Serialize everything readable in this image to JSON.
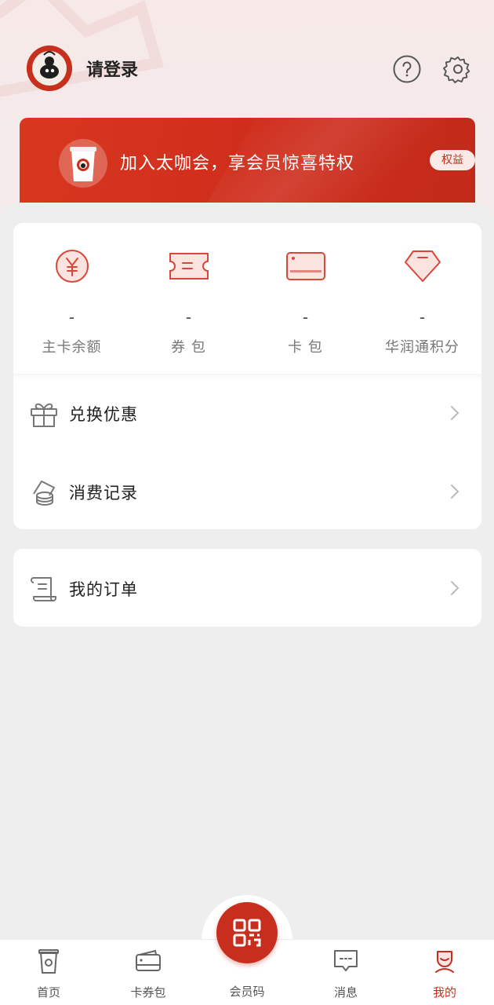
{
  "header": {
    "login_text": "请登录"
  },
  "banner": {
    "text": "加入太咖会，享会员惊喜特权",
    "badge": "权益"
  },
  "assets": [
    {
      "value": "-",
      "label": "主卡余额",
      "icon": "yuan-coin-icon"
    },
    {
      "value": "-",
      "label": "券 包",
      "icon": "ticket-icon"
    },
    {
      "value": "-",
      "label": "卡 包",
      "icon": "card-icon"
    },
    {
      "value": "-",
      "label": "华润通积分",
      "icon": "diamond-icon"
    }
  ],
  "menu": [
    {
      "label": "兑换优惠",
      "icon": "gift-icon"
    },
    {
      "label": "消费记录",
      "icon": "coins-icon"
    }
  ],
  "orders": {
    "label": "我的订单",
    "icon": "receipt-icon"
  },
  "tabbar": {
    "items": [
      {
        "label": "首页",
        "icon": "cup-icon"
      },
      {
        "label": "卡券包",
        "icon": "wallet-icon"
      },
      {
        "label": "会员码",
        "icon": "qrcode-icon"
      },
      {
        "label": "消息",
        "icon": "message-icon"
      },
      {
        "label": "我的",
        "icon": "profile-icon"
      }
    ],
    "active": "我的"
  },
  "colors": {
    "brand": "#c82e1d",
    "icon_stroke": "#d9473a",
    "icon_fill": "#fbe3e0"
  }
}
